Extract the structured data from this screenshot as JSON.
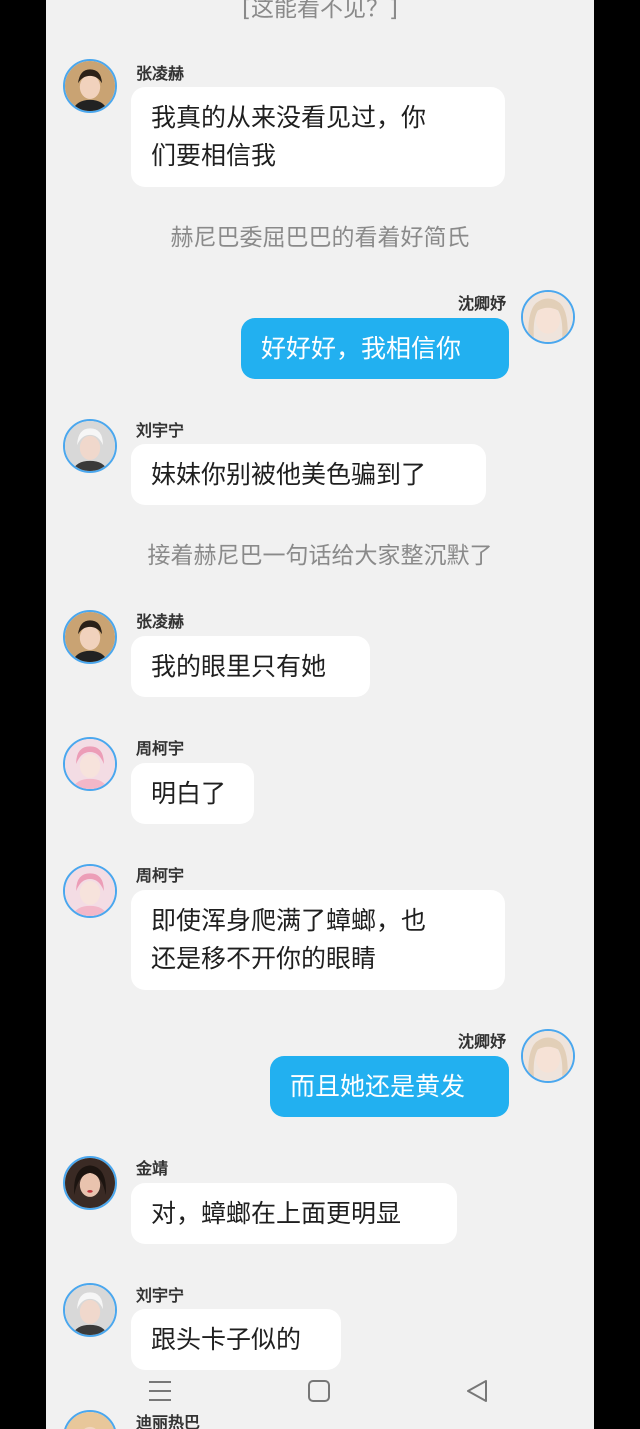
{
  "top_cut_text": "[这能看不见？]",
  "messages": [
    {
      "sender": "张凌赫",
      "text": "我真的从来没看见过，你们要相信我",
      "lines": [
        "我真的从来没看见过，你",
        "们要相信我"
      ]
    },
    {
      "narration": "赫尼巴委屈巴巴的看着好简氏"
    },
    {
      "sender": "沈卿妤",
      "text": "好好好，我相信你",
      "lines": [
        "好好好，我相信你"
      ]
    },
    {
      "sender": "刘宇宁",
      "text": "妹妹你别被他美色骗到了",
      "lines": [
        "妹妹你别被他美色骗到了"
      ]
    },
    {
      "narration": "接着赫尼巴一句话给大家整沉默了"
    },
    {
      "sender": "张凌赫",
      "text": "我的眼里只有她",
      "lines": [
        "我的眼里只有她"
      ]
    },
    {
      "sender": "周柯宇",
      "text": "明白了",
      "lines": [
        "明白了"
      ]
    },
    {
      "sender": "周柯宇",
      "text": "即使浑身爬满了蟑螂，也还是移不开你的眼睛",
      "lines": [
        "即使浑身爬满了蟑螂，也",
        "还是移不开你的眼睛"
      ]
    },
    {
      "sender": "沈卿妤",
      "text": "而且她还是黄发",
      "lines": [
        "而且她还是黄发"
      ]
    },
    {
      "sender": "金靖",
      "text": "对，蟑螂在上面更明显",
      "lines": [
        "对，蟑螂在上面更明显"
      ]
    },
    {
      "sender": "刘宇宁",
      "text": "跟头卡子似的",
      "lines": [
        "跟头卡子似的"
      ]
    },
    {
      "sender": "迪丽热巴"
    }
  ],
  "avatars": {
    "zhang": "man-dark-hair-avatar",
    "shen": "blonde-girl-avatar",
    "liu": "man-white-hair-avatar",
    "zhou": "pink-hair-avatar",
    "jin": "woman-dark-hair-avatar",
    "dili": "woman-avatar"
  },
  "nav": {
    "menu": "menu-icon",
    "home": "home-icon",
    "back": "back-icon"
  },
  "colors": {
    "my_bubble": "#22b0f0",
    "other_bubble": "#ffffff",
    "background": "#f1f1f1",
    "avatar_ring": "#4aa7ee"
  }
}
